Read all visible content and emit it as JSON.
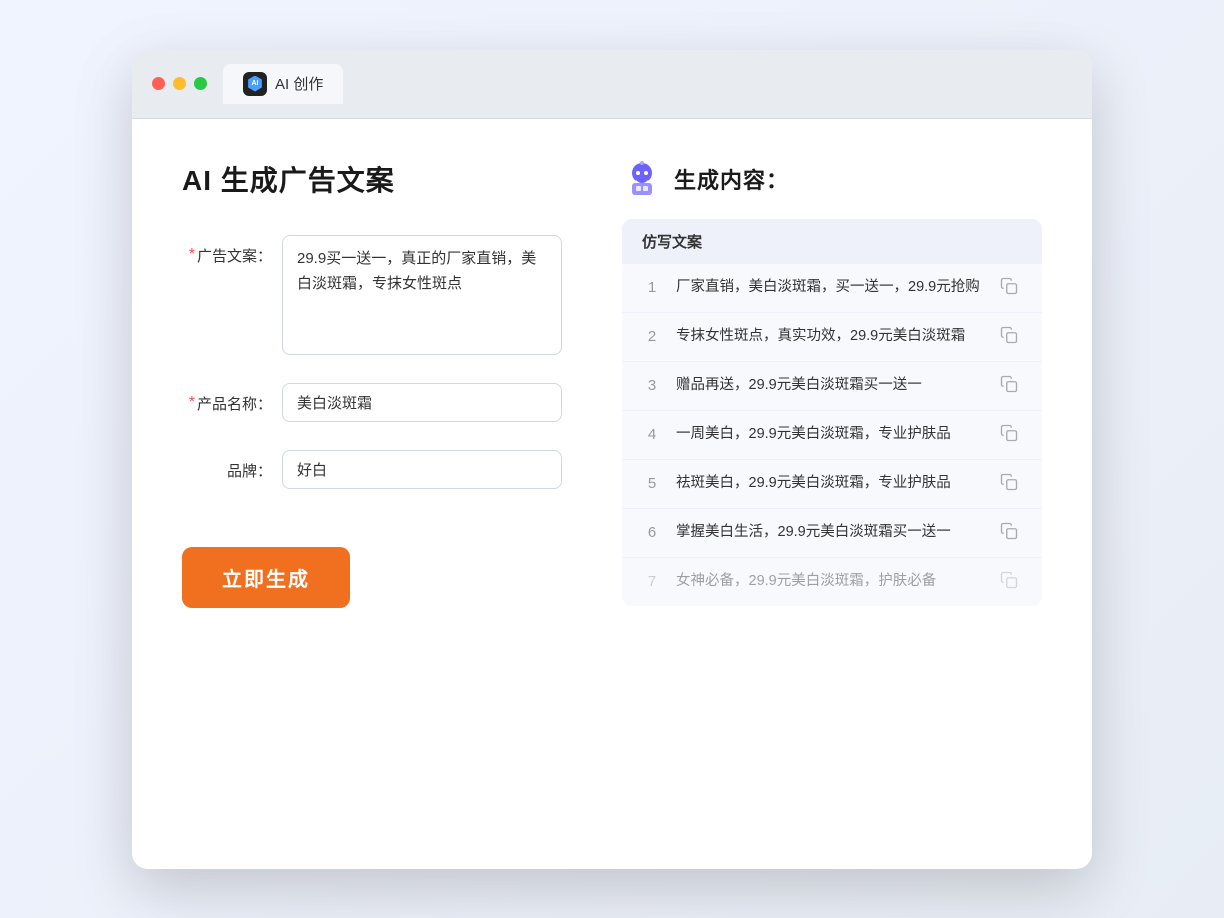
{
  "browser": {
    "tab_label": "AI 创作"
  },
  "page": {
    "title": "AI 生成广告文案",
    "result_header": "生成内容："
  },
  "form": {
    "ad_copy_label": "广告文案：",
    "ad_copy_required": "*",
    "ad_copy_value": "29.9买一送一，真正的厂家直销，美白淡斑霜，专抹女性斑点",
    "product_name_label": "产品名称：",
    "product_name_required": "*",
    "product_name_value": "美白淡斑霜",
    "brand_label": "品牌：",
    "brand_value": "好白",
    "generate_btn": "立即生成"
  },
  "results": {
    "column_header": "仿写文案",
    "items": [
      {
        "id": 1,
        "text": "厂家直销，美白淡斑霜，买一送一，29.9元抢购",
        "faded": false
      },
      {
        "id": 2,
        "text": "专抹女性斑点，真实功效，29.9元美白淡斑霜",
        "faded": false
      },
      {
        "id": 3,
        "text": "赠品再送，29.9元美白淡斑霜买一送一",
        "faded": false
      },
      {
        "id": 4,
        "text": "一周美白，29.9元美白淡斑霜，专业护肤品",
        "faded": false
      },
      {
        "id": 5,
        "text": "祛斑美白，29.9元美白淡斑霜，专业护肤品",
        "faded": false
      },
      {
        "id": 6,
        "text": "掌握美白生活，29.9元美白淡斑霜买一送一",
        "faded": false
      },
      {
        "id": 7,
        "text": "女神必备，29.9元美白淡斑霜，护肤必备",
        "faded": true
      }
    ]
  }
}
